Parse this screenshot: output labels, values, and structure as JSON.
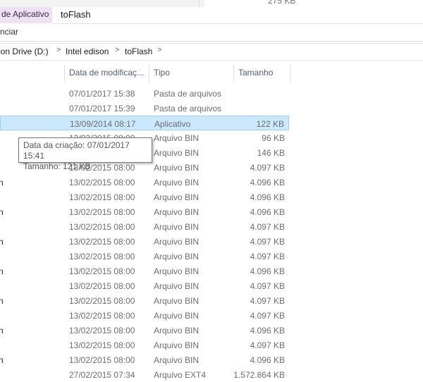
{
  "top": {
    "prev_size": "275 KB"
  },
  "ribbon": {
    "context_tab": "de Aplicativo",
    "window_title": "toFlash",
    "second_tab": "nciar"
  },
  "address": {
    "crumbs": [
      "ion Drive (D:)",
      "Intel edison",
      "toFlash"
    ],
    "separator": ">"
  },
  "columns": {
    "date": "Data de modificaç...",
    "type": "Tipo",
    "size": "Tamanho"
  },
  "rows": [
    {
      "name": "",
      "date": "07/01/2017 15:38",
      "type": "Pasta de arquivos",
      "size": ""
    },
    {
      "name": "",
      "date": "07/01/2017 15:39",
      "type": "Pasta de arquivos",
      "size": ""
    },
    {
      "name": "",
      "date": "13/09/2014 08:17",
      "type": "Aplicativo",
      "size": "122 KB",
      "selected": true
    },
    {
      "name": "",
      "date": "13/02/2015 08:00",
      "type": "Arquivo BIN",
      "size": "96 KB"
    },
    {
      "name": "",
      "date": "13/02/2015 08:00",
      "type": "Arquivo BIN",
      "size": "146 KB"
    },
    {
      "name": "",
      "date": "13/02/2015 08:00",
      "type": "Arquivo BIN",
      "size": "4.097 KB"
    },
    {
      "name": "n",
      "date": "13/02/2015 08:00",
      "type": "Arquivo BIN",
      "size": "4.096 KB"
    },
    {
      "name": "",
      "date": "13/02/2015 08:00",
      "type": "Arquivo BIN",
      "size": "4.096 KB"
    },
    {
      "name": "n",
      "date": "13/02/2015 08:00",
      "type": "Arquivo BIN",
      "size": "4.096 KB"
    },
    {
      "name": "",
      "date": "13/02/2015 08:00",
      "type": "Arquivo BIN",
      "size": "4.097 KB"
    },
    {
      "name": "n",
      "date": "13/02/2015 08:00",
      "type": "Arquivo BIN",
      "size": "4.097 KB"
    },
    {
      "name": "",
      "date": "13/02/2015 08:00",
      "type": "Arquivo BIN",
      "size": "4.097 KB"
    },
    {
      "name": "n",
      "date": "13/02/2015 08:00",
      "type": "Arquivo BIN",
      "size": "4.096 KB"
    },
    {
      "name": "",
      "date": "13/02/2015 08:00",
      "type": "Arquivo BIN",
      "size": "4.097 KB"
    },
    {
      "name": "n",
      "date": "13/02/2015 08:00",
      "type": "Arquivo BIN",
      "size": "4.097 KB"
    },
    {
      "name": "",
      "date": "13/02/2015 08:00",
      "type": "Arquivo BIN",
      "size": "4.097 KB"
    },
    {
      "name": "n",
      "date": "13/02/2015 08:00",
      "type": "Arquivo BIN",
      "size": "4.096 KB"
    },
    {
      "name": "",
      "date": "13/02/2015 08:00",
      "type": "Arquivo BIN",
      "size": "4.097 KB"
    },
    {
      "name": "n",
      "date": "13/02/2015 08:00",
      "type": "Arquivo BIN",
      "size": "4.096 KB"
    },
    {
      "name": "",
      "date": "27/02/2015 07:34",
      "type": "Arquivo EXT4",
      "size": "1.572.864 KB"
    }
  ],
  "tooltip": {
    "line1": "Data da criação: 07/01/2017 15:41",
    "line2": "Tamanho: 121 KB"
  }
}
